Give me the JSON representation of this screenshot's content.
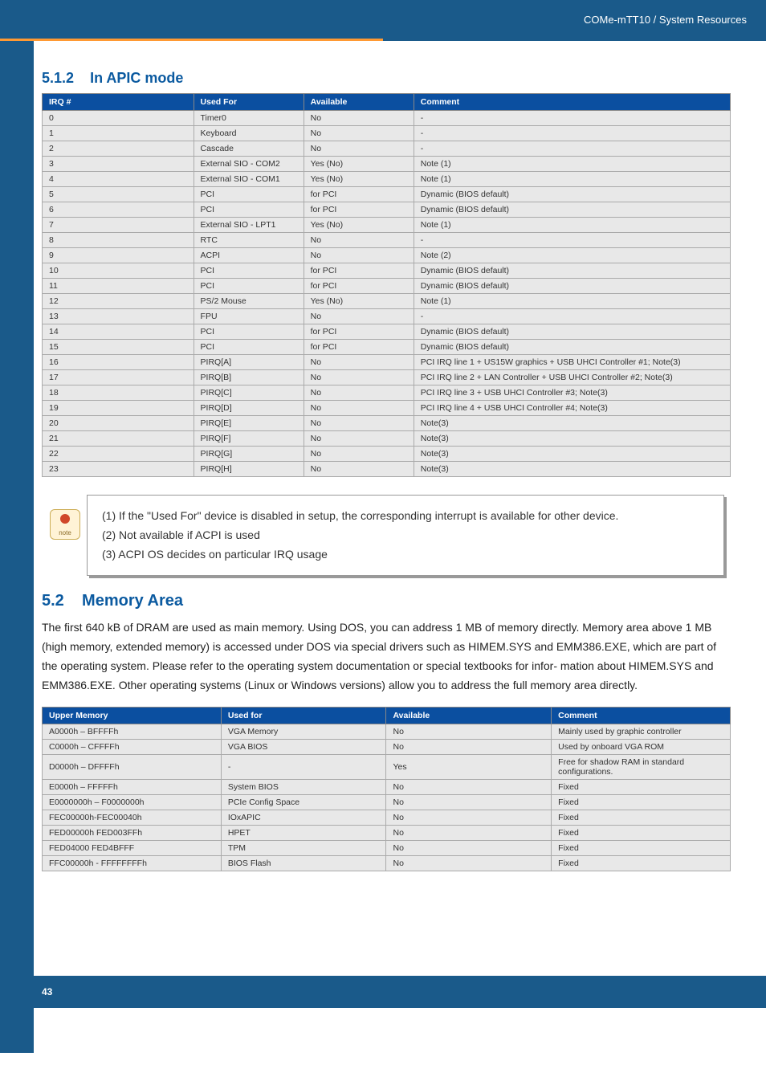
{
  "header": {
    "breadcrumb": "COMe-mTT10 / System Resources"
  },
  "section512": {
    "number": "5.1.2",
    "title": "In APIC mode",
    "headers": [
      "IRQ #",
      "Used For",
      "Available",
      "Comment"
    ],
    "rows": [
      {
        "irq": "0",
        "used": "Timer0",
        "avail": "No",
        "comment": "-"
      },
      {
        "irq": "1",
        "used": "Keyboard",
        "avail": "No",
        "comment": "-"
      },
      {
        "irq": "2",
        "used": "Cascade",
        "avail": "No",
        "comment": "-"
      },
      {
        "irq": "3",
        "used": "External SIO - COM2",
        "avail": "Yes (No)",
        "comment": "Note (1)"
      },
      {
        "irq": "4",
        "used": "External SIO - COM1",
        "avail": "Yes (No)",
        "comment": "Note (1)"
      },
      {
        "irq": "5",
        "used": "PCI",
        "avail": "for PCI",
        "comment": "Dynamic (BIOS default)"
      },
      {
        "irq": "6",
        "used": "PCI",
        "avail": "for PCI",
        "comment": "Dynamic (BIOS default)"
      },
      {
        "irq": "7",
        "used": "External SIO - LPT1",
        "avail": "Yes (No)",
        "comment": "Note (1)"
      },
      {
        "irq": "8",
        "used": "RTC",
        "avail": "No",
        "comment": "-"
      },
      {
        "irq": "9",
        "used": "ACPI",
        "avail": "No",
        "comment": "Note (2)"
      },
      {
        "irq": "10",
        "used": "PCI",
        "avail": "for PCI",
        "comment": "Dynamic (BIOS default)"
      },
      {
        "irq": "11",
        "used": "PCI",
        "avail": "for PCI",
        "comment": "Dynamic (BIOS default)"
      },
      {
        "irq": "12",
        "used": "PS/2 Mouse",
        "avail": "Yes (No)",
        "comment": "Note (1)"
      },
      {
        "irq": "13",
        "used": "FPU",
        "avail": "No",
        "comment": "-"
      },
      {
        "irq": "14",
        "used": "PCI",
        "avail": "for PCI",
        "comment": "Dynamic (BIOS default)"
      },
      {
        "irq": "15",
        "used": "PCI",
        "avail": "for PCI",
        "comment": "Dynamic (BIOS default)"
      },
      {
        "irq": "16",
        "used": "PIRQ[A]",
        "avail": "No",
        "comment": "PCI IRQ line 1 + US15W graphics + USB UHCI Controller #1; Note(3)"
      },
      {
        "irq": "17",
        "used": "PIRQ[B]",
        "avail": "No",
        "comment": "PCI IRQ line 2 + LAN Controller + USB UHCI Controller #2; Note(3)"
      },
      {
        "irq": "18",
        "used": "PIRQ[C]",
        "avail": "No",
        "comment": "PCI IRQ line 3 + USB UHCI Controller #3; Note(3)"
      },
      {
        "irq": "19",
        "used": "PIRQ[D]",
        "avail": "No",
        "comment": "PCI IRQ line 4 + USB UHCI Controller #4; Note(3)"
      },
      {
        "irq": "20",
        "used": "PIRQ[E]",
        "avail": "No",
        "comment": "Note(3)"
      },
      {
        "irq": "21",
        "used": "PIRQ[F]",
        "avail": "No",
        "comment": "Note(3)"
      },
      {
        "irq": "22",
        "used": "PIRQ[G]",
        "avail": "No",
        "comment": "Note(3)"
      },
      {
        "irq": "23",
        "used": "PIRQ[H]",
        "avail": "No",
        "comment": "Note(3)"
      }
    ]
  },
  "notes": {
    "n1": "(1) If the \"Used For\" device is disabled in setup, the corresponding interrupt is available for other device.",
    "n2": "(2) Not available if ACPI is used",
    "n3": "(3) ACPI OS decides on particular IRQ usage"
  },
  "section52": {
    "number": "5.2",
    "title": "Memory Area",
    "para": "The first 640 kB of DRAM are used as main memory. Using DOS, you can address 1 MB of memory directly. Memory area above 1 MB (high memory, extended memory) is accessed under DOS via special drivers such as HIMEM.SYS and EMM386.EXE, which are part of the operating system. Please refer to the operating system documentation or special textbooks for infor- mation about HIMEM.SYS and EMM386.EXE. Other operating systems (Linux or Windows versions) allow you to address the full memory area directly.",
    "headers": [
      "Upper Memory",
      "Used for",
      "Available",
      "Comment"
    ],
    "rows": [
      {
        "mem": "A0000h – BFFFFh",
        "used": "VGA Memory",
        "avail": "No",
        "comment": "Mainly used by graphic controller"
      },
      {
        "mem": "C0000h – CFFFFh",
        "used": "VGA BIOS",
        "avail": "No",
        "comment": "Used by onboard VGA ROM"
      },
      {
        "mem": "D0000h – DFFFFh",
        "used": "-",
        "avail": "Yes",
        "comment": "Free for shadow RAM in standard configurations."
      },
      {
        "mem": "E0000h – FFFFFh",
        "used": "System BIOS",
        "avail": "No",
        "comment": "Fixed"
      },
      {
        "mem": "E0000000h – F0000000h",
        "used": "PCIe Config Space",
        "avail": "No",
        "comment": "Fixed"
      },
      {
        "mem": "FEC00000h-FEC00040h",
        "used": "IOxAPIC",
        "avail": "No",
        "comment": "Fixed"
      },
      {
        "mem": "FED00000h FED003FFh",
        "used": "HPET",
        "avail": "No",
        "comment": "Fixed"
      },
      {
        "mem": "FED04000 FED4BFFF",
        "used": "TPM",
        "avail": "No",
        "comment": "Fixed"
      },
      {
        "mem": "FFC00000h - FFFFFFFFh",
        "used": "BIOS Flash",
        "avail": "No",
        "comment": "Fixed"
      }
    ]
  },
  "footer": {
    "page": "43"
  }
}
